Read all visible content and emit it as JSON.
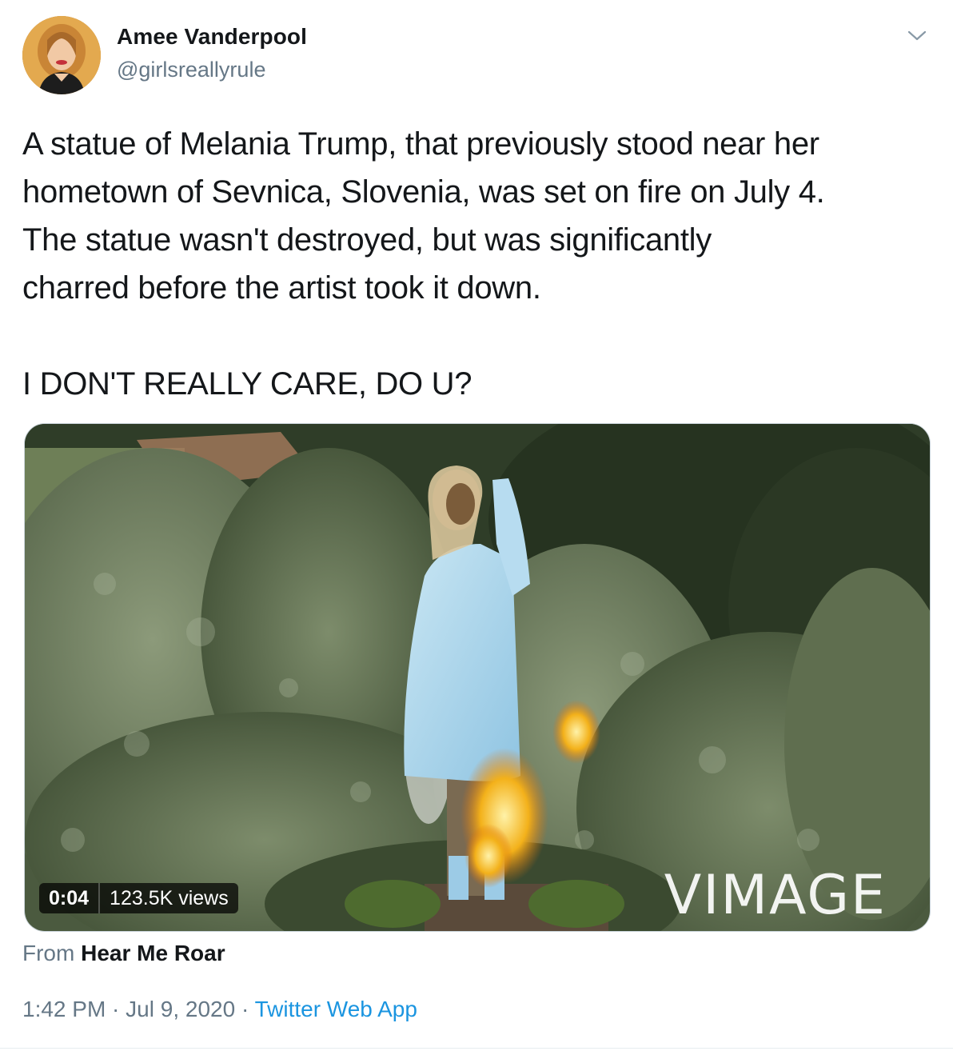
{
  "author": {
    "name": "Amee Vanderpool",
    "handle": "@girlsreallyrule",
    "avatar_icon": "profile-photo"
  },
  "menu": {
    "icon": "chevron-down-icon"
  },
  "tweet": {
    "text": "A statue of Melania Trump, that previously stood near her\nhometown of Sevnica, Slovenia, was set on fire on July 4.\nThe statue wasn't destroyed, but was significantly\ncharred before the artist took it down.",
    "text_second": "I DON'T REALLY CARE, DO U?"
  },
  "media": {
    "duration": "0:04",
    "views": "123.5K views",
    "watermark": "VIMAGE"
  },
  "source": {
    "prefix": "From",
    "name": "Hear Me Roar"
  },
  "meta": {
    "time": "1:42 PM",
    "sep1": " · ",
    "date": "Jul 9, 2020",
    "sep2": " · ",
    "app": "Twitter Web App"
  },
  "colors": {
    "text": "#14171a",
    "secondary": "#657786",
    "link": "#1b95e0"
  }
}
